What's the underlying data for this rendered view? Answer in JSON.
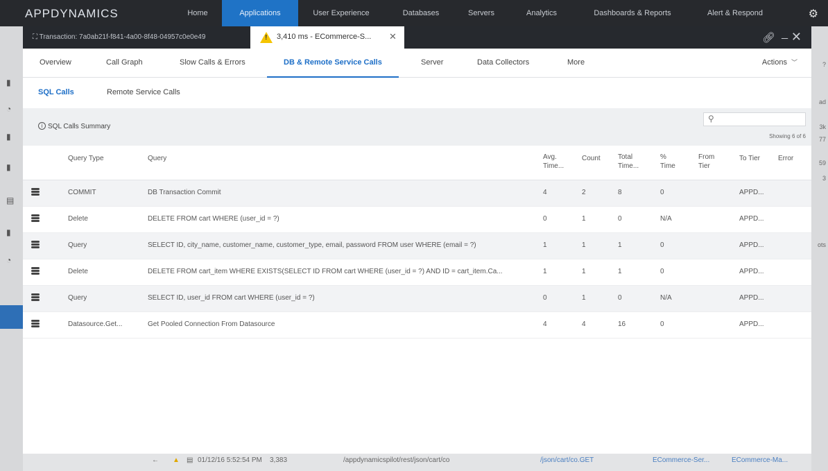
{
  "app": {
    "logo": "APPDYNAMICS",
    "nav": [
      "Home",
      "Applications",
      "User Experience",
      "Databases",
      "Servers",
      "Analytics",
      "Dashboards & Reports",
      "Alert & Respond"
    ],
    "active_nav": "Applications"
  },
  "modal": {
    "transaction_tab": "Transaction: 7a0ab21f-f841-4a00-8f48-04957c0e0e49",
    "bt_tab": "3,410 ms - ECommerce-S...",
    "tabs": [
      "Overview",
      "Call Graph",
      "Slow Calls & Errors",
      "DB & Remote Service Calls",
      "Server",
      "Data Collectors",
      "More"
    ],
    "active_tab": "DB & Remote Service Calls",
    "actions_label": "Actions",
    "sub_tabs": [
      "SQL Calls",
      "Remote Service Calls"
    ],
    "summary_title": "SQL Calls Summary",
    "search_placeholder": "",
    "showing": "Showing 6 of 6"
  },
  "table": {
    "columns": [
      "Query Type",
      "Query",
      "Avg. Time...",
      "Count",
      "Total Time...",
      "% Time",
      "From Tier",
      "To Tier",
      "Error"
    ],
    "rows": [
      {
        "type": "COMMIT",
        "query": "DB Transaction Commit",
        "avg": "4",
        "count": "2",
        "total": "8",
        "pct": "0",
        "from": "",
        "to": "APPD...",
        "error": ""
      },
      {
        "type": "Delete",
        "query": "DELETE FROM cart WHERE (user_id = ?)",
        "avg": "0",
        "count": "1",
        "total": "0",
        "pct": "N/A",
        "from": "",
        "to": "APPD...",
        "error": ""
      },
      {
        "type": "Query",
        "query": "SELECT ID, city_name, customer_name, customer_type, email, password FROM user WHERE (email = ?)",
        "avg": "1",
        "count": "1",
        "total": "1",
        "pct": "0",
        "from": "",
        "to": "APPD...",
        "error": ""
      },
      {
        "type": "Delete",
        "query": "DELETE FROM cart_item WHERE EXISTS(SELECT ID FROM cart WHERE (user_id = ?) AND ID = cart_item.Ca...",
        "avg": "1",
        "count": "1",
        "total": "1",
        "pct": "0",
        "from": "",
        "to": "APPD...",
        "error": ""
      },
      {
        "type": "Query",
        "query": "SELECT ID, user_id FROM cart WHERE (user_id = ?)",
        "avg": "0",
        "count": "1",
        "total": "0",
        "pct": "N/A",
        "from": "",
        "to": "APPD...",
        "error": ""
      },
      {
        "type": "Datasource.Get...",
        "query": "Get Pooled Connection From Datasource",
        "avg": "4",
        "count": "4",
        "total": "16",
        "pct": "0",
        "from": "",
        "to": "APPD...",
        "error": ""
      }
    ]
  },
  "background": {
    "right_labels": [
      "?",
      "ad",
      "3k",
      "77",
      "59",
      "3",
      "ots"
    ],
    "bottom_row": {
      "timestamp": "01/12/16 5:52:54 PM",
      "duration": "3,383",
      "url": "/appdynamicspilot/rest/json/cart/co",
      "bt": "/json/cart/co.GET",
      "tier": "ECommerce-Ser...",
      "node": "ECommerce-Ma..."
    }
  },
  "colors": {
    "accent": "#1e6fc7",
    "top_nav": "#27292d",
    "warning": "#f5c400"
  }
}
